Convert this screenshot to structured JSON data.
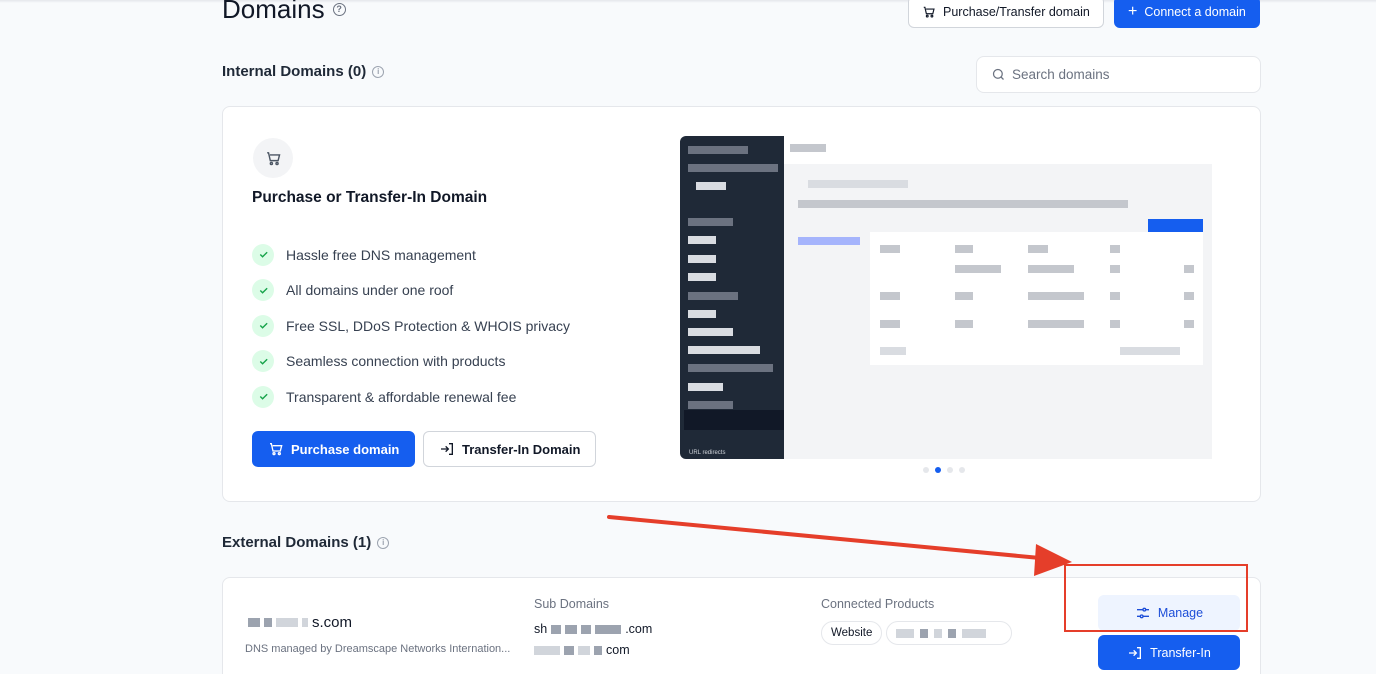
{
  "header": {
    "title": "Domains",
    "purchase_transfer_label": "Purchase/Transfer domain",
    "connect_label": "Connect a domain"
  },
  "internal": {
    "title": "Internal Domains (0)",
    "search_placeholder": "Search domains"
  },
  "promo": {
    "title": "Purchase or Transfer-In Domain",
    "features": [
      "Hassle free DNS management",
      "All domains under one roof",
      "Free SSL, DDoS Protection & WHOIS privacy",
      "Seamless connection with products",
      "Transparent & affordable renewal fee"
    ],
    "purchase_label": "Purchase domain",
    "transfer_label": "Transfer-In Domain",
    "preview_caption": "URL redirects",
    "carousel_active": 2,
    "carousel_count": 4
  },
  "external": {
    "title": "External Domains (1)",
    "domain_suffix": "s.com",
    "dns_text": "DNS managed by Dreamscape Networks Internation...",
    "sub_domains_label": "Sub Domains",
    "sub_1_prefix": "sh",
    "sub_1_suffix": ".com",
    "sub_2_suffix": "com",
    "connected_label": "Connected Products",
    "product_chip": "Website",
    "manage_label": "Manage",
    "transfer_in_label": "Transfer-In"
  },
  "colors": {
    "primary": "#155eef",
    "annotation": "#e53e2a",
    "check_bg": "#dcfce7",
    "check": "#16a34a"
  }
}
